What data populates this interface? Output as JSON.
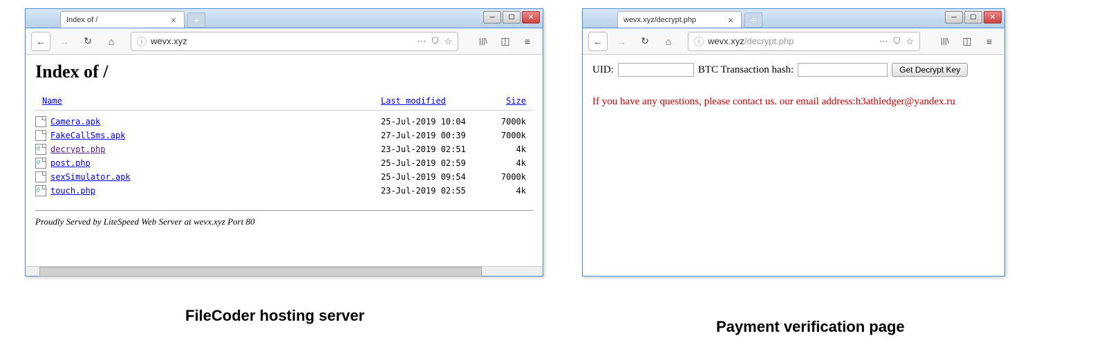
{
  "captions": {
    "left": "FileCoder hosting server",
    "right": "Payment verification page"
  },
  "window1": {
    "tab_title": "Index of /",
    "url_domain": "wevx.xyz",
    "url_path": "",
    "page_heading": "Index of /",
    "headers": {
      "name": "Name",
      "modified": "Last modified",
      "size": "Size"
    },
    "files": [
      {
        "name": "Camera.apk",
        "modified": "25-Jul-2019 10:04",
        "size": "7000k",
        "type": "file",
        "visited": false
      },
      {
        "name": "FakeCallSms.apk",
        "modified": "27-Jul-2019 00:39",
        "size": "7000k",
        "type": "file",
        "visited": false
      },
      {
        "name": "decrypt.php",
        "modified": "23-Jul-2019 02:51",
        "size": "4k",
        "type": "php",
        "visited": true
      },
      {
        "name": "post.php",
        "modified": "25-Jul-2019 02:59",
        "size": "4k",
        "type": "php",
        "visited": false
      },
      {
        "name": "sexSimulator.apk",
        "modified": "25-Jul-2019 09:54",
        "size": "7000k",
        "type": "file",
        "visited": false
      },
      {
        "name": "touch.php",
        "modified": "23-Jul-2019 02:55",
        "size": "4k",
        "type": "php",
        "visited": false
      }
    ],
    "footer": "Proudly Served by LiteSpeed Web Server at wevx.xyz Port 80"
  },
  "window2": {
    "tab_title": "wevx.xyz/decrypt.php",
    "url_domain": "wevx.xyz",
    "url_path": "/decrypt.php",
    "labels": {
      "uid": "UID:",
      "btc": "BTC Transaction hash:",
      "button": "Get Decrypt Key"
    },
    "contact": "If you have any questions, please contact us. our email address:h3athledger@yandex.ru"
  }
}
